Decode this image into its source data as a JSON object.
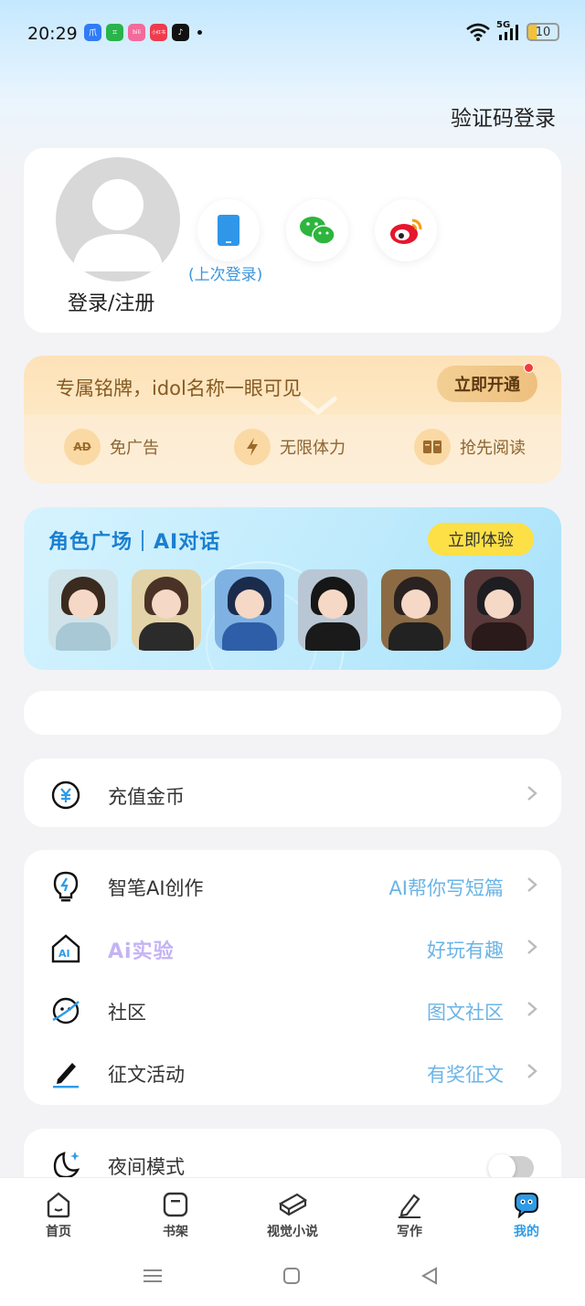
{
  "status_bar": {
    "time": "20:29",
    "network": "5G",
    "battery": "10",
    "app_icons": [
      {
        "name": "baidu-app-icon",
        "color": "#2f7cf6",
        "glyph": "爪"
      },
      {
        "name": "app-store-icon",
        "color": "#28b34b",
        "glyph": "⌗"
      },
      {
        "name": "bilibili-app-icon",
        "color": "#f46a9b",
        "glyph": "bili"
      },
      {
        "name": "xiaohongshu-app-icon",
        "color": "#ef3b4c",
        "glyph": "小红书"
      },
      {
        "name": "tiktok-app-icon",
        "color": "#111111",
        "glyph": "♪"
      }
    ]
  },
  "header": {
    "code_login": "验证码登录"
  },
  "profile": {
    "login_register": "登录/注册",
    "last_login": "(上次登录)",
    "options": [
      "phone-login",
      "wechat-login",
      "weibo-login"
    ]
  },
  "vip": {
    "title": "专属铭牌，idol名称一眼可见",
    "button": "立即开通",
    "perks": [
      {
        "icon": "ad",
        "icon_text": "AD",
        "label": "免广告"
      },
      {
        "icon": "lightning",
        "icon_text": "",
        "label": "无限体力"
      },
      {
        "icon": "book",
        "icon_text": "",
        "label": "抢先阅读"
      }
    ]
  },
  "role_square": {
    "title": "角色广场｜AI对话",
    "button": "立即体验",
    "avatars": [
      {
        "hair": "#3b2a1e",
        "outfit": "#a7c8d4",
        "bg": "#cfe3e9"
      },
      {
        "hair": "#4a3326",
        "outfit": "#2b2b2b",
        "bg": "#e3d3a8"
      },
      {
        "hair": "#1b2b4b",
        "outfit": "#2e5ea8",
        "bg": "#7fb2e2"
      },
      {
        "hair": "#161616",
        "outfit": "#1a1a1a",
        "bg": "#b9c7d4"
      },
      {
        "hair": "#2a2220",
        "outfit": "#222222",
        "bg": "#8c6b44"
      },
      {
        "hair": "#1d1d22",
        "outfit": "#2a1a1a",
        "bg": "#5a3a3a"
      }
    ]
  },
  "menu": {
    "recharge": {
      "label": "充值金币",
      "icon": "coin-yen"
    },
    "items": [
      {
        "label": "智笔AI创作",
        "value": "AI帮你写短篇",
        "icon": "lightbulb"
      },
      {
        "label": "Ai实验",
        "value": "好玩有趣",
        "icon": "ai-house"
      },
      {
        "label": "社区",
        "value": "图文社区",
        "icon": "planet"
      },
      {
        "label": "征文活动",
        "value": "有奖征文",
        "icon": "pen"
      }
    ],
    "night_mode": {
      "label": "夜间模式",
      "enabled": false
    }
  },
  "tabbar": {
    "tabs": [
      {
        "label": "首页",
        "icon": "home"
      },
      {
        "label": "书架",
        "icon": "bookshelf"
      },
      {
        "label": "视觉小说",
        "icon": "visual-novel"
      },
      {
        "label": "写作",
        "icon": "write"
      },
      {
        "label": "我的",
        "icon": "mine",
        "active": true
      }
    ]
  },
  "colors": {
    "accent": "#2c9be8",
    "vip_text": "#865a22",
    "menu_value": "#6bb4e6",
    "role_button": "#fde046"
  }
}
